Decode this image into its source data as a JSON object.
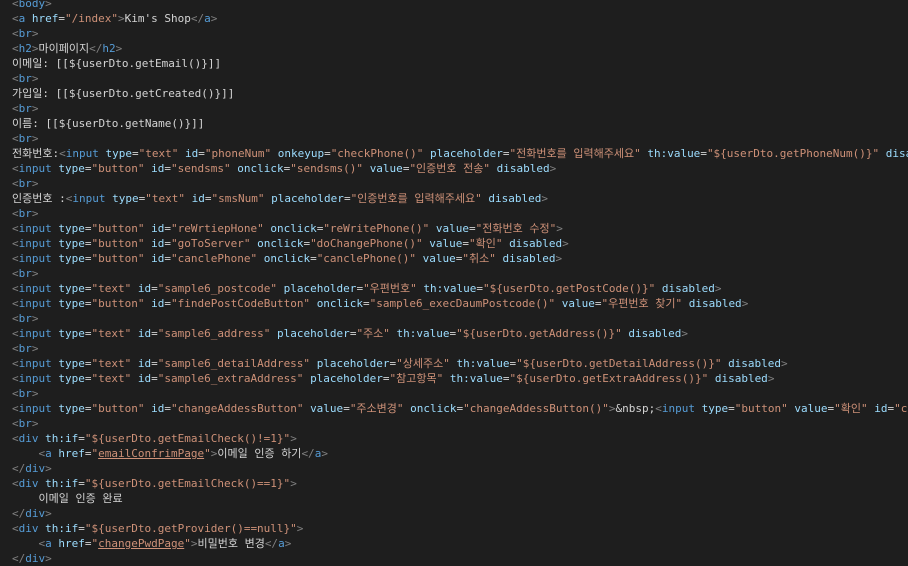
{
  "lines": [
    [
      [
        "t",
        "<"
      ],
      [
        "tag",
        "body"
      ],
      [
        "t",
        ">"
      ]
    ],
    [
      [
        "t",
        "<"
      ],
      [
        "tag",
        "a "
      ],
      [
        "attr",
        "href"
      ],
      [
        "txt",
        "="
      ],
      [
        "str",
        "\"/index\""
      ],
      [
        "t",
        ">"
      ],
      [
        "txt",
        "Kim's Shop"
      ],
      [
        "t",
        "</"
      ],
      [
        "tag",
        "a"
      ],
      [
        "t",
        ">"
      ]
    ],
    [
      [
        "t",
        "<"
      ],
      [
        "tag",
        "br"
      ],
      [
        "t",
        ">"
      ]
    ],
    [
      [
        "t",
        "<"
      ],
      [
        "tag",
        "h2"
      ],
      [
        "t",
        ">"
      ],
      [
        "txt",
        "마이페이지"
      ],
      [
        "t",
        "</"
      ],
      [
        "tag",
        "h2"
      ],
      [
        "t",
        ">"
      ]
    ],
    [
      [
        "txt",
        "이메일: [[${userDto.getEmail()}]]"
      ]
    ],
    [
      [
        "t",
        "<"
      ],
      [
        "tag",
        "br"
      ],
      [
        "t",
        ">"
      ]
    ],
    [
      [
        "txt",
        "가입일: [[${userDto.getCreated()}]]"
      ]
    ],
    [
      [
        "t",
        "<"
      ],
      [
        "tag",
        "br"
      ],
      [
        "t",
        ">"
      ]
    ],
    [
      [
        "txt",
        "이름: [[${userDto.getName()}]]"
      ]
    ],
    [
      [
        "t",
        "<"
      ],
      [
        "tag",
        "br"
      ],
      [
        "t",
        ">"
      ]
    ],
    [
      [
        "txt",
        "전화번호:"
      ],
      [
        "t",
        "<"
      ],
      [
        "tag",
        "input "
      ],
      [
        "attr",
        "type"
      ],
      [
        "txt",
        "="
      ],
      [
        "str",
        "\"text\" "
      ],
      [
        "attr",
        "id"
      ],
      [
        "txt",
        "="
      ],
      [
        "str",
        "\"phoneNum\" "
      ],
      [
        "attr",
        "onkeyup"
      ],
      [
        "txt",
        "="
      ],
      [
        "str",
        "\"checkPhone()\" "
      ],
      [
        "attr",
        "placeholder"
      ],
      [
        "txt",
        "="
      ],
      [
        "str",
        "\"전화번호를 입력해주세요\" "
      ],
      [
        "attr",
        "th:value"
      ],
      [
        "txt",
        "="
      ],
      [
        "str",
        "\"${userDto.getPhoneNum()}\" "
      ],
      [
        "attr",
        "disabled"
      ],
      [
        "t",
        ">"
      ]
    ],
    [
      [
        "t",
        "<"
      ],
      [
        "tag",
        "input "
      ],
      [
        "attr",
        "type"
      ],
      [
        "txt",
        "="
      ],
      [
        "str",
        "\"button\" "
      ],
      [
        "attr",
        "id"
      ],
      [
        "txt",
        "="
      ],
      [
        "str",
        "\"sendsms\" "
      ],
      [
        "attr",
        "onclick"
      ],
      [
        "txt",
        "="
      ],
      [
        "str",
        "\"sendsms()\" "
      ],
      [
        "attr",
        "value"
      ],
      [
        "txt",
        "="
      ],
      [
        "str",
        "\"인증번호 전송\" "
      ],
      [
        "attr",
        "disabled"
      ],
      [
        "t",
        ">"
      ]
    ],
    [
      [
        "t",
        "<"
      ],
      [
        "tag",
        "br"
      ],
      [
        "t",
        ">"
      ]
    ],
    [
      [
        "txt",
        "인증번호 :"
      ],
      [
        "t",
        "<"
      ],
      [
        "tag",
        "input "
      ],
      [
        "attr",
        "type"
      ],
      [
        "txt",
        "="
      ],
      [
        "str",
        "\"text\" "
      ],
      [
        "attr",
        "id"
      ],
      [
        "txt",
        "="
      ],
      [
        "str",
        "\"smsNum\" "
      ],
      [
        "attr",
        "placeholder"
      ],
      [
        "txt",
        "="
      ],
      [
        "str",
        "\"인증번호를 입력해주세요\" "
      ],
      [
        "attr",
        "disabled"
      ],
      [
        "t",
        ">"
      ]
    ],
    [
      [
        "t",
        "<"
      ],
      [
        "tag",
        "br"
      ],
      [
        "t",
        ">"
      ]
    ],
    [
      [
        "t",
        "<"
      ],
      [
        "tag",
        "input "
      ],
      [
        "attr",
        "type"
      ],
      [
        "txt",
        "="
      ],
      [
        "str",
        "\"button\" "
      ],
      [
        "attr",
        "id"
      ],
      [
        "txt",
        "="
      ],
      [
        "str",
        "\"reWrtiepHone\" "
      ],
      [
        "attr",
        "onclick"
      ],
      [
        "txt",
        "="
      ],
      [
        "str",
        "\"reWritePhone()\" "
      ],
      [
        "attr",
        "value"
      ],
      [
        "txt",
        "="
      ],
      [
        "str",
        "\"전화번호 수정\""
      ],
      [
        "t",
        ">"
      ]
    ],
    [
      [
        "t",
        "<"
      ],
      [
        "tag",
        "input "
      ],
      [
        "attr",
        "type"
      ],
      [
        "txt",
        "="
      ],
      [
        "str",
        "\"button\" "
      ],
      [
        "attr",
        "id"
      ],
      [
        "txt",
        "="
      ],
      [
        "str",
        "\"goToServer\" "
      ],
      [
        "attr",
        "onclick"
      ],
      [
        "txt",
        "="
      ],
      [
        "str",
        "\"doChangePhone()\" "
      ],
      [
        "attr",
        "value"
      ],
      [
        "txt",
        "="
      ],
      [
        "str",
        "\"확인\" "
      ],
      [
        "attr",
        "disabled"
      ],
      [
        "t",
        ">"
      ]
    ],
    [
      [
        "t",
        "<"
      ],
      [
        "tag",
        "input "
      ],
      [
        "attr",
        "type"
      ],
      [
        "txt",
        "="
      ],
      [
        "str",
        "\"button\" "
      ],
      [
        "attr",
        "id"
      ],
      [
        "txt",
        "="
      ],
      [
        "str",
        "\"canclePhone\" "
      ],
      [
        "attr",
        "onclick"
      ],
      [
        "txt",
        "="
      ],
      [
        "str",
        "\"canclePhone()\" "
      ],
      [
        "attr",
        "value"
      ],
      [
        "txt",
        "="
      ],
      [
        "str",
        "\"취소\" "
      ],
      [
        "attr",
        "disabled"
      ],
      [
        "t",
        ">"
      ]
    ],
    [
      [
        "t",
        "<"
      ],
      [
        "tag",
        "br"
      ],
      [
        "t",
        ">"
      ]
    ],
    [
      [
        "t",
        "<"
      ],
      [
        "tag",
        "input "
      ],
      [
        "attr",
        "type"
      ],
      [
        "txt",
        "="
      ],
      [
        "str",
        "\"text\" "
      ],
      [
        "attr",
        "id"
      ],
      [
        "txt",
        "="
      ],
      [
        "str",
        "\"sample6_postcode\" "
      ],
      [
        "attr",
        "placeholder"
      ],
      [
        "txt",
        "="
      ],
      [
        "str",
        "\"우편번호\" "
      ],
      [
        "attr",
        "th:value"
      ],
      [
        "txt",
        "="
      ],
      [
        "str",
        "\"${userDto.getPostCode()}\" "
      ],
      [
        "attr",
        "disabled"
      ],
      [
        "t",
        ">"
      ]
    ],
    [
      [
        "t",
        "<"
      ],
      [
        "tag",
        "input "
      ],
      [
        "attr",
        "type"
      ],
      [
        "txt",
        "="
      ],
      [
        "str",
        "\"button\" "
      ],
      [
        "attr",
        "id"
      ],
      [
        "txt",
        "="
      ],
      [
        "str",
        "\"findePostCodeButton\" "
      ],
      [
        "attr",
        "onclick"
      ],
      [
        "txt",
        "="
      ],
      [
        "str",
        "\"sample6_execDaumPostcode()\" "
      ],
      [
        "attr",
        "value"
      ],
      [
        "txt",
        "="
      ],
      [
        "str",
        "\"우편번호 찾기\" "
      ],
      [
        "attr",
        "disabled"
      ],
      [
        "t",
        ">"
      ]
    ],
    [
      [
        "t",
        "<"
      ],
      [
        "tag",
        "br"
      ],
      [
        "t",
        ">"
      ]
    ],
    [
      [
        "t",
        "<"
      ],
      [
        "tag",
        "input "
      ],
      [
        "attr",
        "type"
      ],
      [
        "txt",
        "="
      ],
      [
        "str",
        "\"text\" "
      ],
      [
        "attr",
        "id"
      ],
      [
        "txt",
        "="
      ],
      [
        "str",
        "\"sample6_address\" "
      ],
      [
        "attr",
        "placeholder"
      ],
      [
        "txt",
        "="
      ],
      [
        "str",
        "\"주소\" "
      ],
      [
        "attr",
        "th:value"
      ],
      [
        "txt",
        "="
      ],
      [
        "str",
        "\"${userDto.getAddress()}\" "
      ],
      [
        "attr",
        "disabled"
      ],
      [
        "t",
        ">"
      ]
    ],
    [
      [
        "t",
        "<"
      ],
      [
        "tag",
        "br"
      ],
      [
        "t",
        ">"
      ]
    ],
    [
      [
        "t",
        "<"
      ],
      [
        "tag",
        "input "
      ],
      [
        "attr",
        "type"
      ],
      [
        "txt",
        "="
      ],
      [
        "str",
        "\"text\" "
      ],
      [
        "attr",
        "id"
      ],
      [
        "txt",
        "="
      ],
      [
        "str",
        "\"sample6_detailAddress\" "
      ],
      [
        "attr",
        "placeholder"
      ],
      [
        "txt",
        "="
      ],
      [
        "str",
        "\"상세주소\" "
      ],
      [
        "attr",
        "th:value"
      ],
      [
        "txt",
        "="
      ],
      [
        "str",
        "\"${userDto.getDetailAddress()}\" "
      ],
      [
        "attr",
        "disabled"
      ],
      [
        "t",
        ">"
      ]
    ],
    [
      [
        "t",
        "<"
      ],
      [
        "tag",
        "input "
      ],
      [
        "attr",
        "type"
      ],
      [
        "txt",
        "="
      ],
      [
        "str",
        "\"text\" "
      ],
      [
        "attr",
        "id"
      ],
      [
        "txt",
        "="
      ],
      [
        "str",
        "\"sample6_extraAddress\" "
      ],
      [
        "attr",
        "placeholder"
      ],
      [
        "txt",
        "="
      ],
      [
        "str",
        "\"참고항목\" "
      ],
      [
        "attr",
        "th:value"
      ],
      [
        "txt",
        "="
      ],
      [
        "str",
        "\"${userDto.getExtraAddress()}\" "
      ],
      [
        "attr",
        "disabled"
      ],
      [
        "t",
        ">"
      ]
    ],
    [
      [
        "t",
        "<"
      ],
      [
        "tag",
        "br"
      ],
      [
        "t",
        ">"
      ]
    ],
    [
      [
        "t",
        "<"
      ],
      [
        "tag",
        "input "
      ],
      [
        "attr",
        "type"
      ],
      [
        "txt",
        "="
      ],
      [
        "str",
        "\"button\" "
      ],
      [
        "attr",
        "id"
      ],
      [
        "txt",
        "="
      ],
      [
        "str",
        "\"changeAddessButton\" "
      ],
      [
        "attr",
        "value"
      ],
      [
        "txt",
        "="
      ],
      [
        "str",
        "\"주소변경\" "
      ],
      [
        "attr",
        "onclick"
      ],
      [
        "txt",
        "="
      ],
      [
        "str",
        "\"changeAddessButton()\""
      ],
      [
        "t",
        ">"
      ],
      [
        "txt",
        "&nbsp;"
      ],
      [
        "t",
        "<"
      ],
      [
        "tag",
        "input "
      ],
      [
        "attr",
        "type"
      ],
      [
        "txt",
        "="
      ],
      [
        "str",
        "\"button\" "
      ],
      [
        "attr",
        "value"
      ],
      [
        "txt",
        "="
      ],
      [
        "str",
        "\"확인\" "
      ],
      [
        "attr",
        "id"
      ],
      [
        "txt",
        "="
      ],
      [
        "str",
        "\"changeAddres"
      ]
    ],
    [
      [
        "t",
        "<"
      ],
      [
        "tag",
        "br"
      ],
      [
        "t",
        ">"
      ]
    ],
    [
      [
        "t",
        "<"
      ],
      [
        "tag",
        "div "
      ],
      [
        "attr",
        "th:if"
      ],
      [
        "txt",
        "="
      ],
      [
        "str",
        "\"${userDto.getEmailCheck()!=1}\""
      ],
      [
        "t",
        ">"
      ]
    ],
    [
      [
        "txt",
        "    "
      ],
      [
        "t",
        "<"
      ],
      [
        "tag",
        "a "
      ],
      [
        "attr",
        "href"
      ],
      [
        "txt",
        "="
      ],
      [
        "str",
        "\""
      ],
      [
        "str u",
        "emailConfrimPage"
      ],
      [
        "str",
        "\""
      ],
      [
        "t",
        ">"
      ],
      [
        "txt",
        "이메일 인증 하기"
      ],
      [
        "t",
        "</"
      ],
      [
        "tag",
        "a"
      ],
      [
        "t",
        ">"
      ]
    ],
    [
      [
        "t",
        "</"
      ],
      [
        "tag",
        "div"
      ],
      [
        "t",
        ">"
      ]
    ],
    [
      [
        "t",
        "<"
      ],
      [
        "tag",
        "div "
      ],
      [
        "attr",
        "th:if"
      ],
      [
        "txt",
        "="
      ],
      [
        "str",
        "\"${userDto.getEmailCheck()==1}\""
      ],
      [
        "t",
        ">"
      ]
    ],
    [
      [
        "txt",
        "    이메일 인증 완료"
      ]
    ],
    [
      [
        "t",
        "</"
      ],
      [
        "tag",
        "div"
      ],
      [
        "t",
        ">"
      ]
    ],
    [
      [
        "t",
        "<"
      ],
      [
        "tag",
        "div "
      ],
      [
        "attr",
        "th:if"
      ],
      [
        "txt",
        "="
      ],
      [
        "str",
        "\"${userDto.getProvider()==null}\""
      ],
      [
        "t",
        ">"
      ]
    ],
    [
      [
        "txt",
        "    "
      ],
      [
        "t",
        "<"
      ],
      [
        "tag",
        "a "
      ],
      [
        "attr",
        "href"
      ],
      [
        "txt",
        "="
      ],
      [
        "str",
        "\""
      ],
      [
        "str u",
        "changePwdPage"
      ],
      [
        "str",
        "\""
      ],
      [
        "t",
        ">"
      ],
      [
        "txt",
        "비밀번호 변경"
      ],
      [
        "t",
        "</"
      ],
      [
        "tag",
        "a"
      ],
      [
        "t",
        ">"
      ]
    ],
    [
      [
        "t",
        "</"
      ],
      [
        "tag",
        "div"
      ],
      [
        "t",
        ">"
      ]
    ]
  ]
}
